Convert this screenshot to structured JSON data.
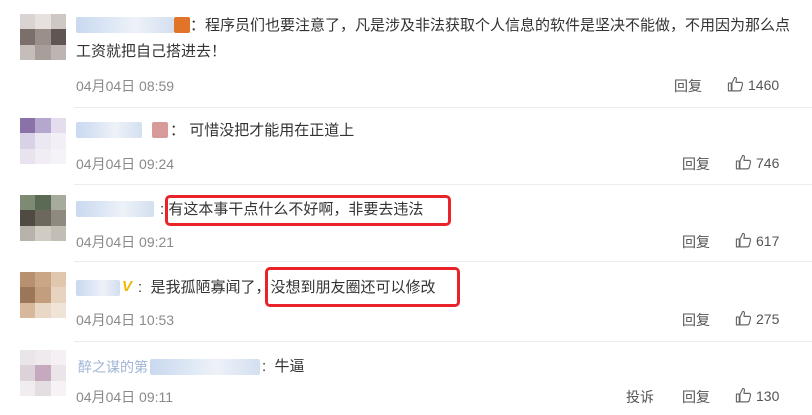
{
  "comments": [
    {
      "text_line1": "程序员们也要注意了，凡是涉及非法获取个人信息的软件是坚决不能做，不用因为那么点",
      "text_line2": "工资就把自己搭进去！",
      "time": "04月04日 08:59",
      "reply_label": "回复",
      "likes": "1460"
    },
    {
      "text": "可惜没把才能用在正道上",
      "time": "04月04日 09:24",
      "reply_label": "回复",
      "likes": "746"
    },
    {
      "text": "有这本事干点什么不好啊，非要去违法",
      "time": "04月04日 09:21",
      "reply_label": "回复",
      "likes": "617"
    },
    {
      "text_before": "是我孤陋寡闻了，",
      "text_highlight": "没想到朋友圈还可以修改",
      "time": "04月04日 10:53",
      "reply_label": "回复",
      "likes": "275"
    },
    {
      "name_partial": "醉之谋的第",
      "text": "牛逼",
      "time": "04月04日 09:11",
      "report_label": "投诉",
      "reply_label": "回复",
      "likes": "130"
    }
  ],
  "colors": {
    "highlight": "#e8242a",
    "link_blue": "#3b6fb6",
    "muted": "#8a8a8a"
  }
}
